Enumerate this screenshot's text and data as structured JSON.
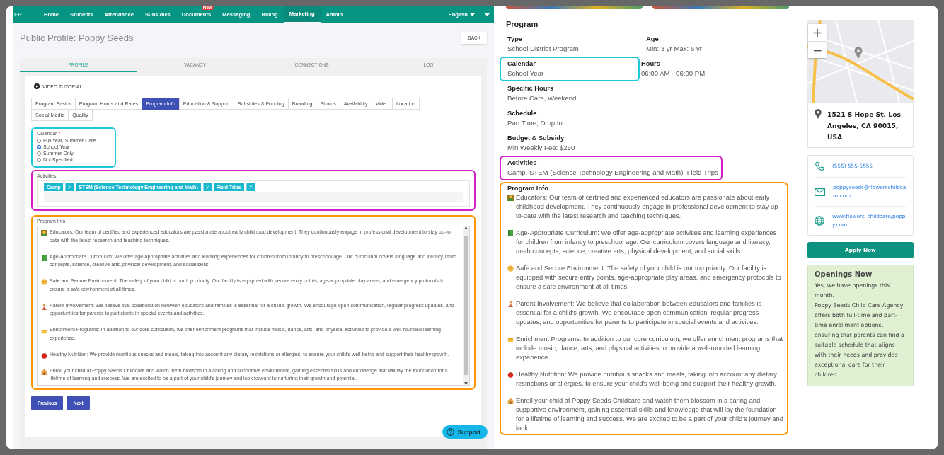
{
  "nav": {
    "logo": "ER",
    "items": [
      {
        "label": "Home",
        "selected": false
      },
      {
        "label": "Students",
        "selected": false
      },
      {
        "label": "Attendance",
        "selected": false
      },
      {
        "label": "Subsidies",
        "selected": false
      },
      {
        "label": "Documents",
        "selected": false,
        "badge": "New"
      },
      {
        "label": "Messaging",
        "selected": false
      },
      {
        "label": "Billing",
        "selected": false
      },
      {
        "label": "Marketing",
        "selected": true
      },
      {
        "label": "Admin",
        "selected": false
      }
    ],
    "language": "English"
  },
  "page": {
    "title": "Public Profile: Poppy Seeds",
    "back": "BACK"
  },
  "tabs": [
    {
      "label": "PROFILE",
      "selected": true
    },
    {
      "label": "VACANCY",
      "selected": false
    },
    {
      "label": "CONNECTIONS",
      "selected": false
    },
    {
      "label": "LOG",
      "selected": false
    }
  ],
  "video_tutorial": "VIDEO TUTORIAL",
  "section_tabs": [
    {
      "label": "Program Basics",
      "selected": false
    },
    {
      "label": "Program Hours and Rates",
      "selected": false
    },
    {
      "label": "Program Info",
      "selected": true
    },
    {
      "label": "Education & Support",
      "selected": false
    },
    {
      "label": "Subsidies & Funding",
      "selected": false
    },
    {
      "label": "Branding",
      "selected": false
    },
    {
      "label": "Photos",
      "selected": false
    },
    {
      "label": "Availability",
      "selected": false
    },
    {
      "label": "Video",
      "selected": false
    },
    {
      "label": "Location",
      "selected": false
    },
    {
      "label": "Social Media",
      "selected": false
    },
    {
      "label": "Quality",
      "selected": false
    }
  ],
  "calendar": {
    "label": "Calendar",
    "required_mark": "*",
    "color": "#1ec8d8",
    "options": [
      {
        "label": "Full Year, Summer Care",
        "selected": false
      },
      {
        "label": "School Year",
        "selected": true
      },
      {
        "label": "Summer Only",
        "selected": false
      },
      {
        "label": "Not Specified",
        "selected": false
      }
    ]
  },
  "activities": {
    "label": "Activities",
    "color": "#d21ec3",
    "tags": [
      "Camp",
      "STEM (Science Technology Engineering and Math)",
      "Field Trips"
    ]
  },
  "program_info": {
    "label": "Program Info",
    "color": "#ff9800",
    "paragraphs": [
      "Educators: Our team of certified and experienced educators are passionate about early childhood development. They continuously engage in professional development to stay up-to-date with the latest research and teaching techniques.",
      "Age-Appropriate Curriculum: We offer age-appropriate activities and learning experiences for children from infancy to preschool age. Our curriculum covers language and literacy, math concepts, science, creative arts, physical development, and social skills.",
      "Safe and Secure Environment: The safety of your child is our top priority. Our facility is equipped with secure entry points, age-appropriate play areas, and emergency protocols to ensure a safe environment at all times.",
      "Parent Involvement: We believe that collaboration between educators and families is essential for a child's growth. We encourage open communication, regular progress updates, and opportunities for parents to participate in special events and activities.",
      "Enrichment Programs: In addition to our core curriculum, we offer enrichment programs that include music, dance, arts, and physical activities to provide a well-rounded learning experience.",
      "Healthy Nutrition: We provide nutritious snacks and meals, taking into account any dietary restrictions or allergies, to ensure your child's well-being and support their healthy growth.",
      "Enroll your child at Poppy Seeds Childcare and watch them blossom in a caring and supportive environment, gaining essential skills and knowledge that will lay the foundation for a lifetime of learning and success. We are excited to be a part of your child's journey and look forward to nurturing their growth and potential."
    ]
  },
  "buttons": [
    "Previous",
    "Next"
  ],
  "support": "Support",
  "preview": {
    "heading": "Program",
    "rows": [
      [
        {
          "label": "Type",
          "value": "School District Program"
        },
        {
          "label": "Age",
          "value": "Min: 3 yr Max: 6 yr"
        }
      ],
      [
        {
          "label": "Calendar",
          "value": "School Year",
          "color": "#1ec8d8"
        },
        {
          "label": "Hours",
          "value": "06:00 AM - 06:00 PM"
        }
      ],
      [
        {
          "label": "Specific Hours",
          "value": "Before Care, Weekend"
        }
      ],
      [
        {
          "label": "Schedule",
          "value": "Part Time, Drop In"
        }
      ],
      [
        {
          "label": "Budget & Subsidy",
          "value": "Min Weekly Fee: $250"
        }
      ],
      [
        {
          "label": "Activities",
          "value": "Camp, STEM (Science Technology Engineering and Math), Field Trips",
          "color": "#d21ec3"
        }
      ]
    ],
    "program_info": {
      "label": "Program Info",
      "color": "#ff9800",
      "paragraphs": [
        "Educators: Our team of certified and experienced educators are passionate about early childhood development. They continuously engage in professional development to stay up-to-date with the latest research and teaching techniques.",
        "Age-Appropriate Curriculum: We offer age-appropriate activities and learning experiences for children from infancy to preschool age. Our curriculum covers language and literacy, math concepts, science, creative arts, physical development, and social skills.",
        "Safe and Secure Environment: The safety of your child is our top priority. Our facility is equipped with secure entry points, age-appropriate play areas, and emergency protocols to ensure a safe environment at all times.",
        "Parent Involvement: We believe that collaboration between educators and families is essential for a child's growth. We encourage open communication, regular progress updates, and opportunities for parents to participate in special events and activities.",
        "Enrichment Programs: In addition to our core curriculum, we offer enrichment programs that include music, dance, arts, and physical activities to provide a well-rounded learning experience.",
        "Healthy Nutrition: We provide nutritious snacks and meals, taking into account any dietary restrictions or allergies, to ensure your child's well-being and support their healthy growth.",
        "Enroll your child at Poppy Seeds Childcare and watch them blossom in a caring and supportive environment, gaining essential skills and knowledge that will lay the foundation for a lifetime of learning and success. We are excited to be a part of your child's journey and look"
      ]
    }
  },
  "sidebar": {
    "map_controls": [
      "+",
      "−"
    ],
    "address": "1521 S Hope St, Los Angeles, CA 90015, USA",
    "contacts": [
      {
        "kind": "phone",
        "text": "(555) 555-5555"
      },
      {
        "kind": "email",
        "text": "poppyseeds@flowerschildcare.com"
      },
      {
        "kind": "website",
        "text": "www.flowers_childcare/poppy.com"
      }
    ],
    "apply": "Apply Now",
    "openings": {
      "title": "Openings Now",
      "lines": [
        "Yes, we have openings this month.",
        "Poppy Seeds Child Care Agency offers both full-time and part-time enrollment options, ensuring that parents can find a suitable schedule that aligns with their needs and provides exceptional care for their children."
      ]
    }
  }
}
